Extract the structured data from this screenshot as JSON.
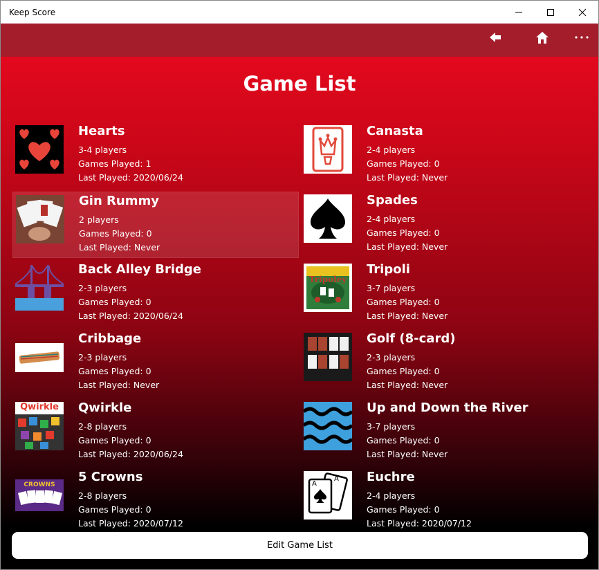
{
  "window": {
    "title": "Keep Score"
  },
  "commandbar": {
    "back_icon": "back-arrow-icon",
    "home_icon": "home-icon",
    "more_icon": "more-icon"
  },
  "page": {
    "title": "Game List"
  },
  "games": [
    {
      "name": "Hearts",
      "players": "3-4 players",
      "played": "Games Played: 1",
      "last": "Last Played: 2020/06/24",
      "icon": "hearts-image"
    },
    {
      "name": "Canasta",
      "players": "2-4 players",
      "played": "Games Played: 0",
      "last": "Last Played: Never",
      "icon": "canasta-joker-image"
    },
    {
      "name": "Gin Rummy",
      "players": "2 players",
      "played": "Games Played: 0",
      "last": "Last Played: Never",
      "icon": "gin-rummy-cards-image"
    },
    {
      "name": "Spades",
      "players": "2-4 players",
      "played": "Games Played: 0",
      "last": "Last Played: Never",
      "icon": "spade-image"
    },
    {
      "name": "Back Alley Bridge",
      "players": "2-3 players",
      "played": "Games Played: 0",
      "last": "Last Played: 2020/06/24",
      "icon": "bridge-image"
    },
    {
      "name": "Tripoli",
      "players": "3-7 players",
      "played": "Games Played: 0",
      "last": "Last Played: Never",
      "icon": "tripoli-box-image"
    },
    {
      "name": "Cribbage",
      "players": "2-3 players",
      "played": "Games Played: 0",
      "last": "Last Played: Never",
      "icon": "cribbage-board-image"
    },
    {
      "name": "Golf (8-card)",
      "players": "2-3 players",
      "played": "Games Played: 0",
      "last": "Last Played: Never",
      "icon": "golf-cards-image"
    },
    {
      "name": "Qwirkle",
      "players": "2-8 players",
      "played": "Games Played: 0",
      "last": "Last Played: 2020/06/24",
      "icon": "qwirkle-box-image"
    },
    {
      "name": "Up and Down the River",
      "players": "3-7 players",
      "played": "Games Played: 0",
      "last": "Last Played: Never",
      "icon": "waves-image"
    },
    {
      "name": "5 Crowns",
      "players": "2-8 players",
      "played": "Games Played: 0",
      "last": "Last Played: 2020/07/12",
      "icon": "five-crowns-box-image"
    },
    {
      "name": "Euchre",
      "players": "2-4 players",
      "played": "Games Played: 0",
      "last": "Last Played: 2020/07/12",
      "icon": "aces-cards-image"
    }
  ],
  "thumb_text": {
    "qwirkle": "Qwirkle",
    "tripoli": "Tripoley",
    "five_crowns": "CROWNS",
    "ace": "A"
  },
  "footer": {
    "edit_label": "Edit Game List"
  },
  "colors": {
    "commandbar": "#a31d2b",
    "accent_top": "#e3081d",
    "heart": "#e8443a"
  }
}
